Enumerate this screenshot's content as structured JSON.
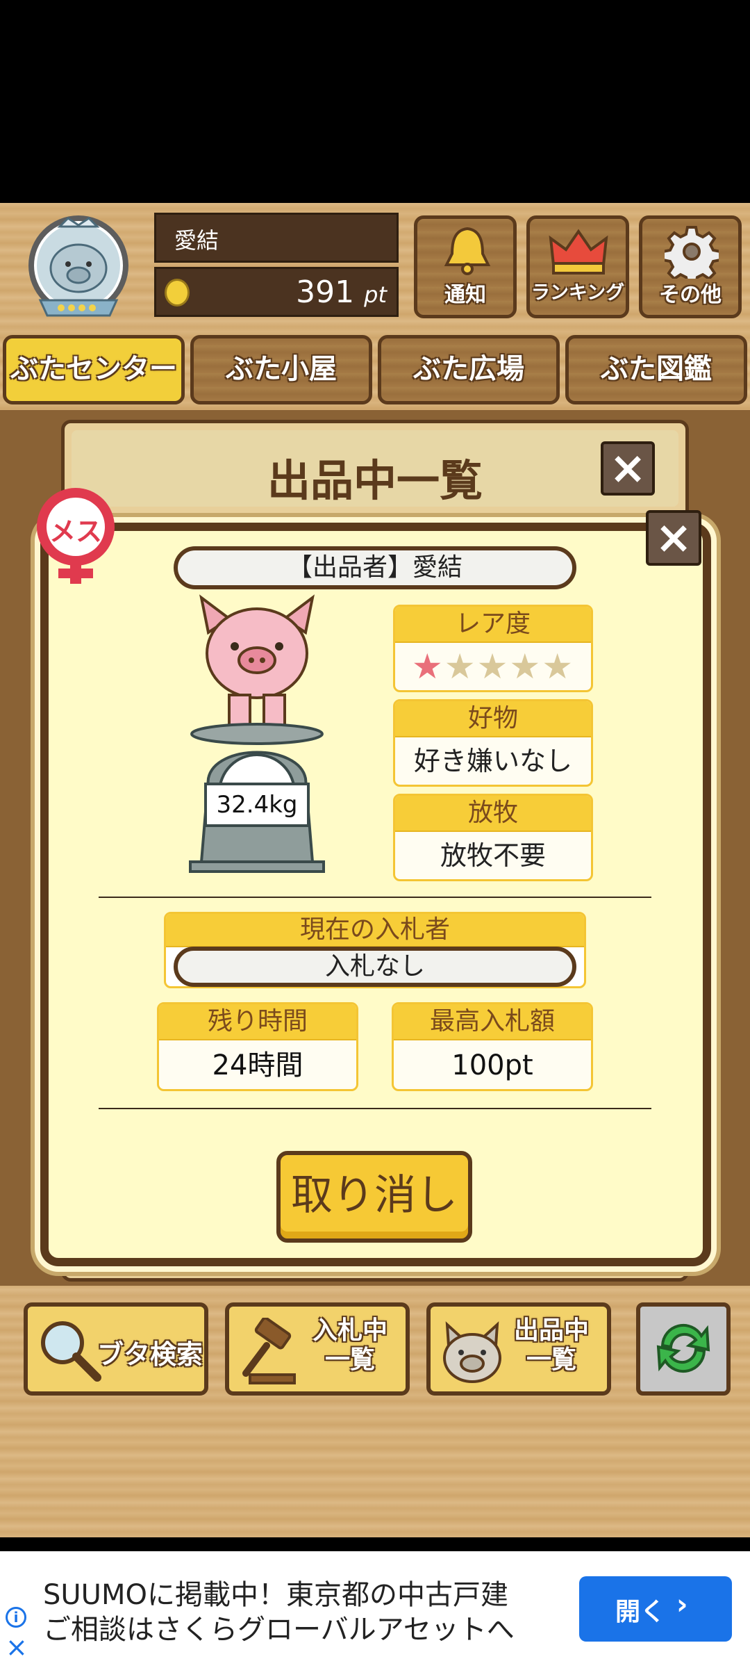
{
  "header": {
    "user_name": "愛結",
    "points": "391",
    "points_unit": "pt",
    "buttons": [
      {
        "label": "通知",
        "icon": "bell-icon"
      },
      {
        "label": "ランキング",
        "icon": "crown-icon"
      },
      {
        "label": "その他",
        "icon": "gear-icon"
      }
    ]
  },
  "nav_tabs": [
    "ぶたセンター",
    "ぶた小屋",
    "ぶた広場",
    "ぶた図鑑"
  ],
  "panel": {
    "title": "出品中一覧",
    "gender_badge": "メス",
    "seller": "【出品者】愛結",
    "weight": "32.4kg",
    "rarity_label": "レア度",
    "rarity_stars": 1,
    "rarity_max": 5,
    "favorite_label": "好物",
    "favorite_value": "好き嫌いなし",
    "grazing_label": "放牧",
    "grazing_value": "放牧不要",
    "bidder_label": "現在の入札者",
    "bidder_value": "入札なし",
    "time_label": "残り時間",
    "time_value": "24時間",
    "max_bid_label": "最高入札額",
    "max_bid_value": "100pt",
    "cancel_button": "取り消し"
  },
  "bottom_buttons": [
    {
      "label": "ブタ検索",
      "icon": "magnifier-icon"
    },
    {
      "label": "入札中\n一覧",
      "icon": "gavel-icon"
    },
    {
      "label": "出品中\n一覧",
      "icon": "pig-face-icon"
    },
    {
      "label": "",
      "icon": "refresh-icon"
    }
  ],
  "ad": {
    "line1": "SUUMOに掲載中！東京都の中古戸建",
    "line2": "ご相談はさくらグローバルアセットへ",
    "button": "開く"
  },
  "colors": {
    "accent_yellow": "#f7cd38",
    "wood": "#d8b37c",
    "panel_bg": "#fffbc8",
    "ad_button": "#1a73e8"
  }
}
